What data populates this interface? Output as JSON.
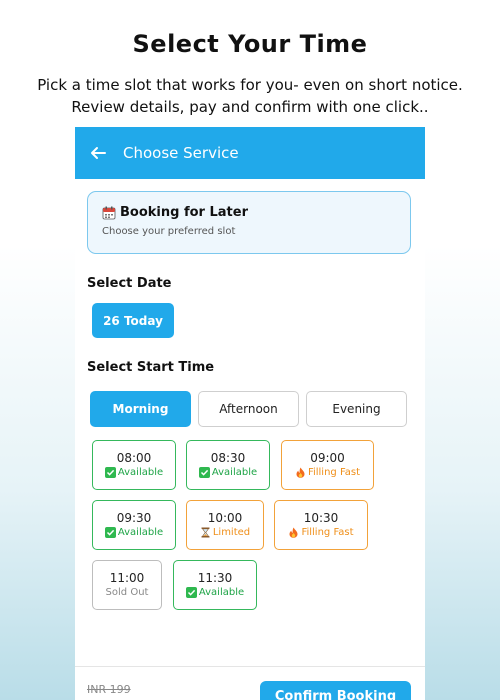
{
  "promo": {
    "headline": "Select Your Time",
    "subline": "Pick a time slot that works for you- even on short notice. Review details, pay and confirm with one click.."
  },
  "appbar": {
    "title": "Choose Service",
    "back_icon": "arrow-left-icon"
  },
  "booking_card": {
    "icon": "calendar-icon",
    "title": "Booking for Later",
    "subtitle": "Choose your preferred slot"
  },
  "date_section": {
    "label": "Select Date",
    "selected_date": "26 Today"
  },
  "time_section": {
    "label": "Select Start Time",
    "tabs": [
      "Morning",
      "Afternoon",
      "Evening"
    ],
    "active_tab": "Morning",
    "slots": [
      {
        "time": "08:00",
        "status": "Available",
        "kind": "available",
        "icon": "check-icon"
      },
      {
        "time": "08:30",
        "status": "Available",
        "kind": "available",
        "icon": "check-icon"
      },
      {
        "time": "09:00",
        "status": "Filling Fast",
        "kind": "filling",
        "icon": "fire-icon"
      },
      {
        "time": "09:30",
        "status": "Available",
        "kind": "available",
        "icon": "check-icon"
      },
      {
        "time": "10:00",
        "status": "Limited",
        "kind": "limited",
        "icon": "hourglass-icon"
      },
      {
        "time": "10:30",
        "status": "Filling Fast",
        "kind": "filling",
        "icon": "fire-icon"
      },
      {
        "time": "11:00",
        "status": "Sold Out",
        "kind": "sold",
        "icon": ""
      },
      {
        "time": "11:30",
        "status": "Available",
        "kind": "available",
        "icon": "check-icon"
      }
    ]
  },
  "footer": {
    "old_price": "INR 199",
    "confirm_label": "Confirm Booking"
  },
  "colors": {
    "accent": "#21a9ea",
    "available": "#35b85c",
    "filling": "#f2a23a",
    "sold": "#bdbdbd"
  }
}
